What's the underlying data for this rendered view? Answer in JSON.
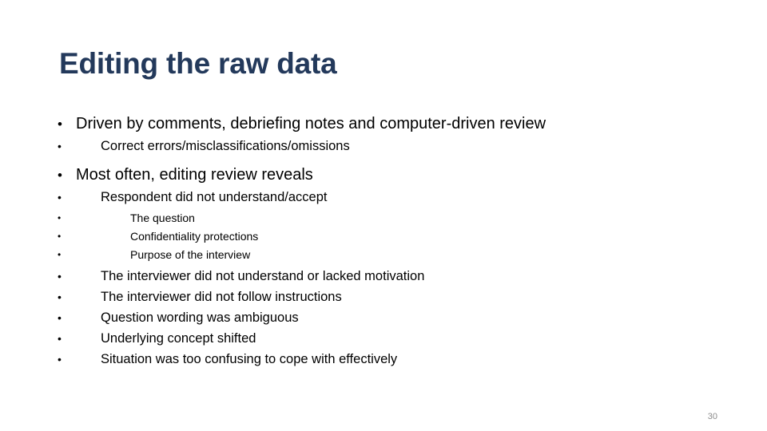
{
  "slide": {
    "title": "Editing the raw data",
    "page_number": "30",
    "bullet_glyph": "•",
    "colors": {
      "title": "#23395B",
      "body_text": "#000000",
      "page_number": "#8C8C8C",
      "background": "#FFFFFF"
    },
    "content": [
      {
        "level": 1,
        "text": "Driven by comments, debriefing notes and computer-driven review"
      },
      {
        "level": 2,
        "text": "Correct errors/misclassifications/omissions"
      },
      {
        "level": 1,
        "text": "Most often, editing review reveals"
      },
      {
        "level": 2,
        "text": "Respondent did not understand/accept"
      },
      {
        "level": 3,
        "text": "The question"
      },
      {
        "level": 3,
        "text": "Confidentiality protections"
      },
      {
        "level": 3,
        "text": "Purpose of the interview"
      },
      {
        "level": 2,
        "text": "The interviewer did not understand or lacked motivation"
      },
      {
        "level": 2,
        "text": "The interviewer did not follow instructions"
      },
      {
        "level": 2,
        "text": "Question wording was ambiguous"
      },
      {
        "level": 2,
        "text": "Underlying concept shifted"
      },
      {
        "level": 2,
        "text": "Situation was too confusing to cope with effectively"
      }
    ]
  }
}
